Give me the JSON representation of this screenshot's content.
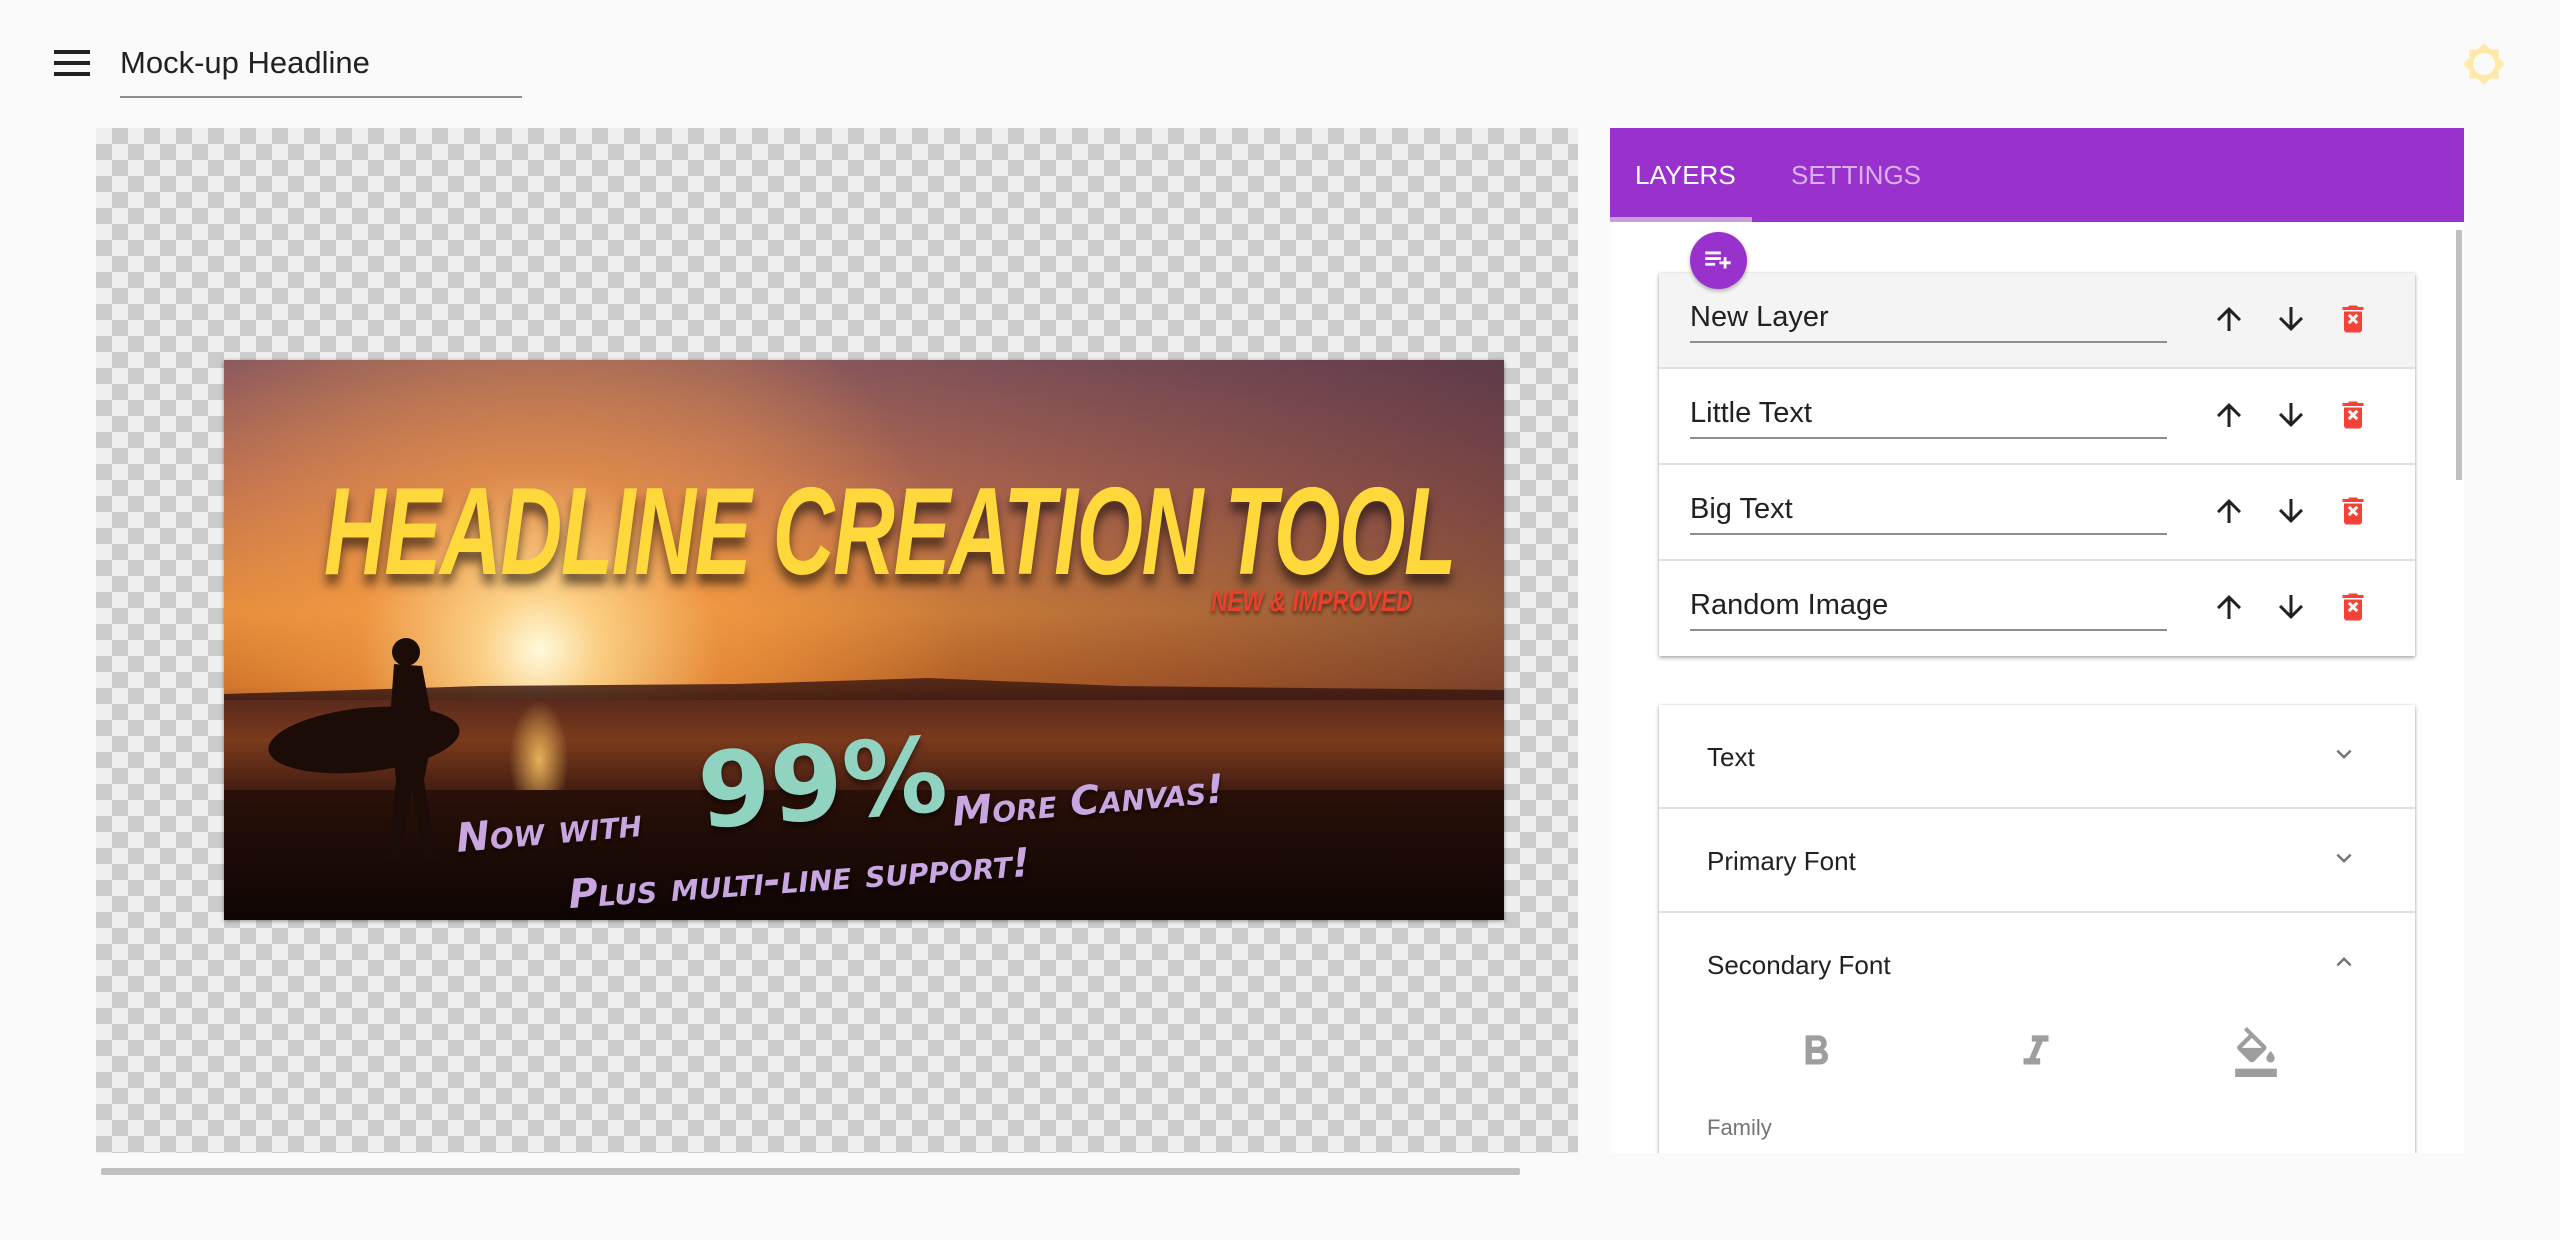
{
  "header": {
    "menu_icon": "hamburger-menu-icon",
    "title_value": "Mock-up Headline",
    "theme_icon": "brightness-sun-icon",
    "theme_icon_color": "#FFE9A8"
  },
  "canvas": {
    "headline": "HEADLINE CREATION TOOL",
    "subheadline": "NEW & IMPROVED",
    "line1_pre": "Now with",
    "line1_big": "99%",
    "line1_post": "More Canvas!",
    "line2": "Plus multi-line support!",
    "colors": {
      "headline": "#FFD93B",
      "subheadline": "#E8402A",
      "secondary": "#C9A6E0",
      "accent": "#8FD3C0"
    }
  },
  "panel": {
    "accent": "#9932CC",
    "tabs": [
      {
        "label": "LAYERS",
        "active": true
      },
      {
        "label": "SETTINGS",
        "active": false
      }
    ],
    "add_layer_icon": "playlist-add-icon",
    "layers": [
      {
        "name": "New Layer",
        "selected": true
      },
      {
        "name": "Little Text",
        "selected": false
      },
      {
        "name": "Big Text",
        "selected": false
      },
      {
        "name": "Random Image",
        "selected": false
      }
    ],
    "sections": [
      {
        "label": "Text",
        "expanded": false
      },
      {
        "label": "Primary Font",
        "expanded": false
      },
      {
        "label": "Secondary Font",
        "expanded": true
      }
    ],
    "font_tools": [
      "bold-icon",
      "italic-icon",
      "fill-color-icon"
    ],
    "family_label": "Family"
  }
}
